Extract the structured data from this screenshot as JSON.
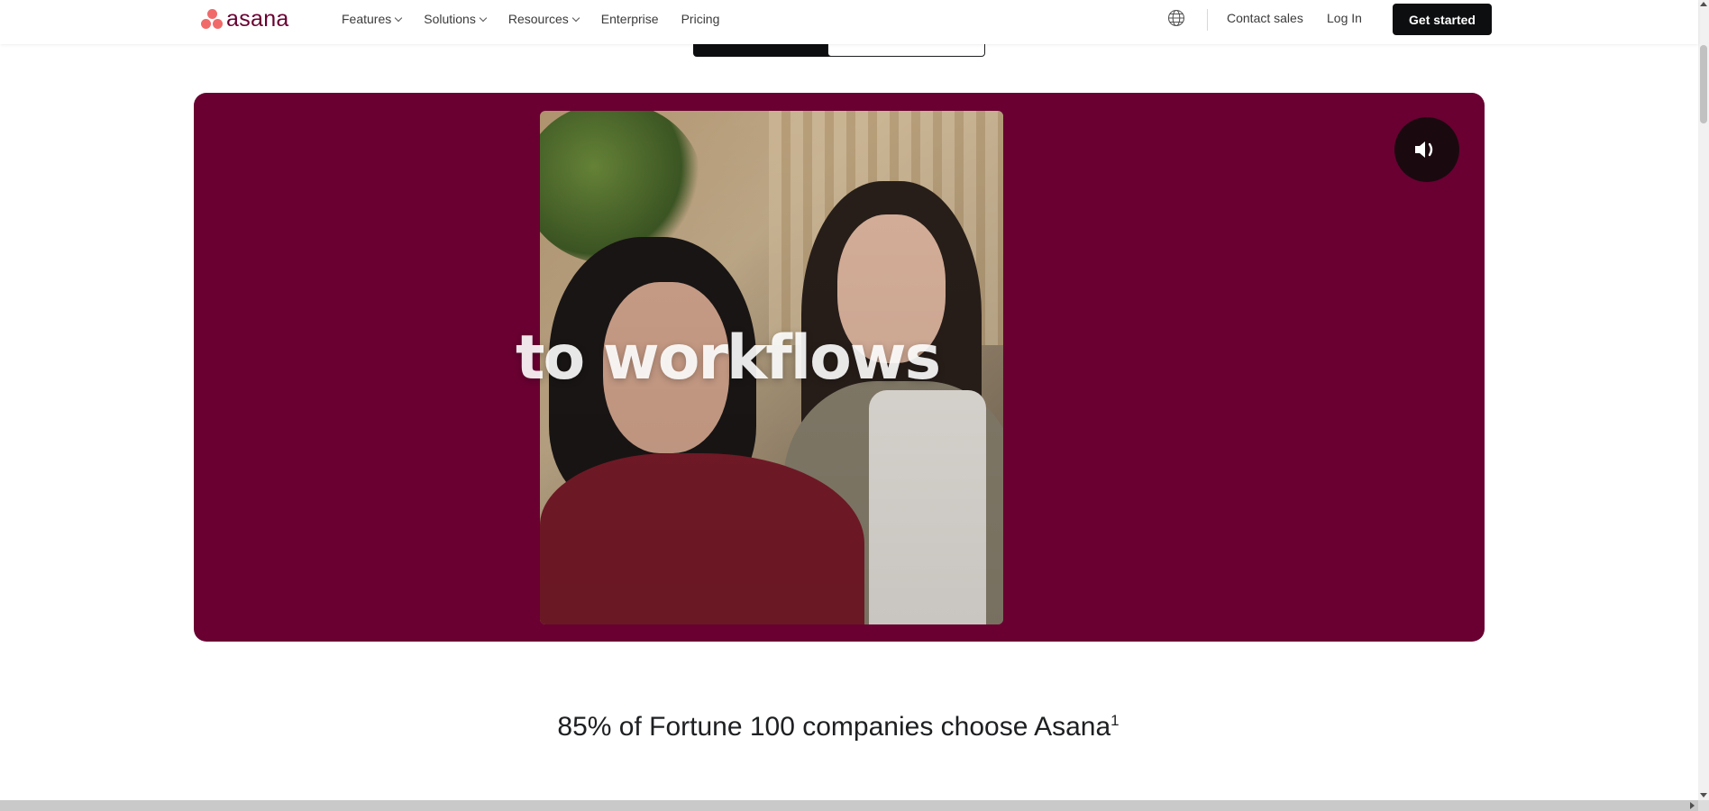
{
  "brand": {
    "name": "asana",
    "color": "#690031",
    "dot_color": "#f06a6a"
  },
  "nav": {
    "items": [
      {
        "label": "Features",
        "has_dropdown": true
      },
      {
        "label": "Solutions",
        "has_dropdown": true
      },
      {
        "label": "Resources",
        "has_dropdown": true
      },
      {
        "label": "Enterprise",
        "has_dropdown": false
      },
      {
        "label": "Pricing",
        "has_dropdown": false
      }
    ],
    "globe_icon": "globe-icon",
    "contact_sales": "Contact sales",
    "log_in": "Log In",
    "get_started": "Get started"
  },
  "video": {
    "background_color": "#690031",
    "overlay_text": "to workflows",
    "sound_icon": "speaker-icon"
  },
  "headline": {
    "text": "85% of Fortune 100 companies choose Asana",
    "footnote": "1"
  }
}
